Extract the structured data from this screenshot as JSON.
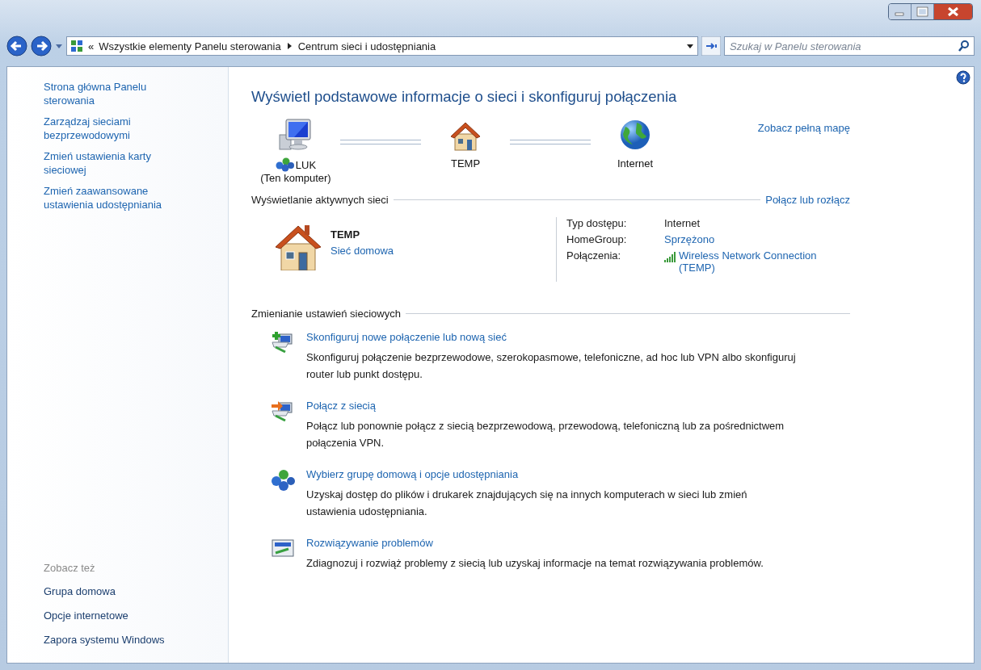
{
  "address_bar": {
    "overflow_marker": "«",
    "breadcrumbs": [
      "Wszystkie elementy Panelu sterowania",
      "Centrum sieci i udostępniania"
    ]
  },
  "search": {
    "placeholder": "Szukaj w Panelu sterowania"
  },
  "sidebar": {
    "items": [
      "Strona główna Panelu sterowania",
      "Zarządzaj sieciami bezprzewodowymi",
      "Zmień ustawienia karty sieciowej",
      "Zmień zaawansowane ustawienia udostępniania"
    ],
    "see_also_heading": "Zobacz też",
    "see_also": [
      "Grupa domowa",
      "Opcje internetowe",
      "Zapora systemu Windows"
    ]
  },
  "main": {
    "title": "Wyświetl podstawowe informacje o sieci i skonfiguruj połączenia",
    "map": {
      "full_map_link": "Zobacz pełną mapę",
      "nodes": [
        {
          "kind": "computer",
          "label": "LUK",
          "sublabel": "(Ten komputer)"
        },
        {
          "kind": "home",
          "label": "TEMP"
        },
        {
          "kind": "internet",
          "label": "Internet"
        }
      ]
    },
    "active_networks": {
      "heading": "Wyświetlanie aktywnych sieci",
      "link": "Połącz lub rozłącz",
      "network": {
        "name": "TEMP",
        "type": "Sieć domowa"
      },
      "properties": [
        {
          "kind": "text",
          "label": "Typ dostępu:",
          "value": "Internet"
        },
        {
          "kind": "link",
          "label": "HomeGroup:",
          "value": "Sprzężono"
        },
        {
          "kind": "wifi",
          "label": "Połączenia:",
          "value": "Wireless Network Connection (TEMP)"
        }
      ]
    },
    "change_settings": {
      "heading": "Zmienianie ustawień sieciowych",
      "tasks": [
        {
          "kind": "new-connection",
          "title": "Skonfiguruj nowe połączenie lub nową sieć",
          "description": "Skonfiguruj połączenie bezprzewodowe, szerokopasmowe, telefoniczne, ad hoc lub VPN albo skonfiguruj router lub punkt dostępu."
        },
        {
          "kind": "connect",
          "title": "Połącz z siecią",
          "description": "Połącz lub ponownie połącz z siecią bezprzewodową, przewodową, telefoniczną lub za pośrednictwem połączenia VPN."
        },
        {
          "kind": "homegroup",
          "title": "Wybierz grupę domową i opcje udostępniania",
          "description": "Uzyskaj dostęp do plików i drukarek znajdujących się na innych komputerach w sieci lub zmień ustawienia udostępniania."
        },
        {
          "kind": "troubleshoot",
          "title": "Rozwiązywanie problemów",
          "description": "Zdiagnozuj i rozwiąż problemy z siecią lub uzyskaj informacje na temat rozwiązywania problemów."
        }
      ]
    }
  }
}
